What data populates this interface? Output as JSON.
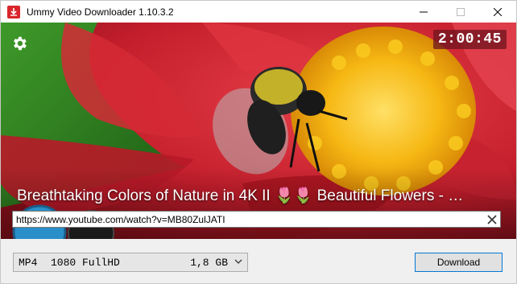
{
  "window": {
    "title": "Ummy Video Downloader 1.10.3.2",
    "controls": [
      "minimize-icon",
      "maximize-icon",
      "close-icon"
    ]
  },
  "video": {
    "duration": "2:00:45",
    "title": "Breathtaking Colors of Nature in 4K II 🌷🌷 Beautiful Flowers - …",
    "url": "https://www.youtube.com/watch?v=MB80ZulJATI"
  },
  "format": {
    "type": "MP4",
    "quality": "1080 FullHD",
    "size": "1,8 GB"
  },
  "download_label": "Download",
  "colors": {
    "accent": "#0078d7",
    "app_icon": "#d9262c"
  }
}
